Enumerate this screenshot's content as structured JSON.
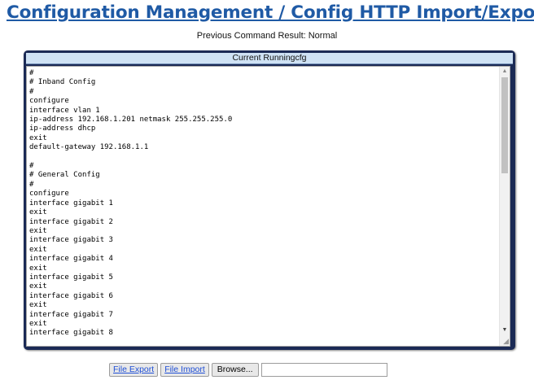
{
  "page": {
    "title": "Configuration Management / Config HTTP Import/Export",
    "result_text": "Previous Command Result: Normal"
  },
  "config_panel": {
    "header": "Current Runningcfg",
    "content": "#\n# Inband Config\n#\nconfigure\ninterface vlan 1\nip-address 192.168.1.201 netmask 255.255.255.0\nip-address dhcp\nexit\ndefault-gateway 192.168.1.1\n\n#\n# General Config\n#\nconfigure\ninterface gigabit 1\nexit\ninterface gigabit 2\nexit\ninterface gigabit 3\nexit\ninterface gigabit 4\nexit\ninterface gigabit 5\nexit\ninterface gigabit 6\nexit\ninterface gigabit 7\nexit\ninterface gigabit 8",
    "scroll_up_icon": "triangle-up-icon",
    "scroll_down_icon": "triangle-down-icon",
    "resize_icon": "resize-grip-icon"
  },
  "actions": {
    "file_export_label": "File Export",
    "file_import_label": "File Import",
    "browse_label": "Browse...",
    "file_name_value": ""
  },
  "colors": {
    "title": "#1f5aa5",
    "frame": "#1b2a55",
    "header_bg": "#cfe2f4",
    "link": "#1f4fd6"
  }
}
